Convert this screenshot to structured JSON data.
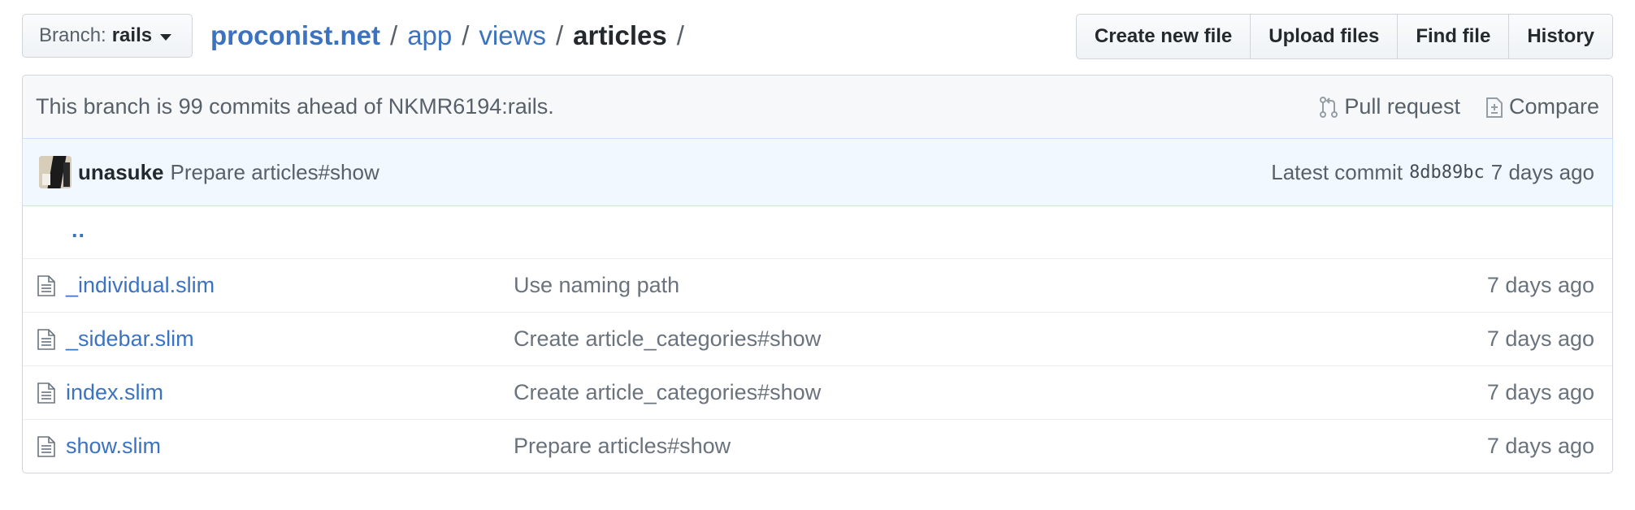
{
  "branch": {
    "label": "Branch:",
    "name": "rails"
  },
  "breadcrumb": {
    "root": "proconist.net",
    "segments": [
      "app",
      "views"
    ],
    "current": "articles",
    "separator": "/"
  },
  "file_actions": {
    "create": "Create new file",
    "upload": "Upload files",
    "find": "Find file",
    "history": "History"
  },
  "branch_info": {
    "message": "This branch is 99 commits ahead of NKMR6194:rails.",
    "pull_request": "Pull request",
    "compare": "Compare"
  },
  "latest_commit": {
    "author": "unasuke",
    "message": "Prepare articles#show",
    "label": "Latest commit",
    "sha": "8db89bc",
    "age": "7 days ago"
  },
  "files": {
    "up": "..",
    "rows": [
      {
        "name": "_individual.slim",
        "message": "Use naming path",
        "age": "7 days ago"
      },
      {
        "name": "_sidebar.slim",
        "message": "Create article_categories#show",
        "age": "7 days ago"
      },
      {
        "name": "index.slim",
        "message": "Create article_categories#show",
        "age": "7 days ago"
      },
      {
        "name": "show.slim",
        "message": "Prepare articles#show",
        "age": "7 days ago"
      }
    ]
  }
}
